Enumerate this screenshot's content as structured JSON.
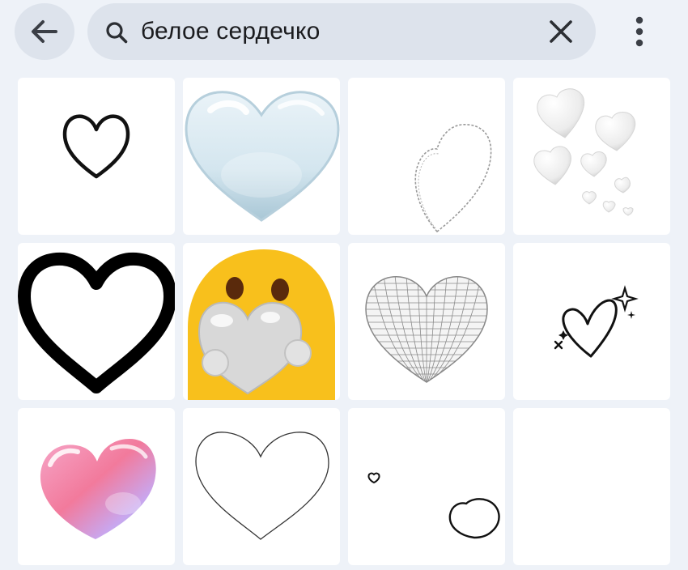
{
  "search": {
    "query": "белое сердечко"
  },
  "icons": {
    "back": "arrow-left-icon",
    "search": "search-icon",
    "clear": "close-icon",
    "more": "more-vertical-icon"
  },
  "colors": {
    "background": "#eef2f8",
    "search_bar": "#dde3ec",
    "tile": "#ffffff",
    "emoji_yellow": "#f8c01c"
  },
  "results": [
    {
      "name": "small-black-outline-heart"
    },
    {
      "name": "light-blue-glossy-heart"
    },
    {
      "name": "dotted-sketch-heart"
    },
    {
      "name": "white-puffy-hearts-cluster"
    },
    {
      "name": "thick-black-outline-heart"
    },
    {
      "name": "emoji-face-hugging-white-heart"
    },
    {
      "name": "wireframe-mesh-heart"
    },
    {
      "name": "doodle-heart-with-sparkles"
    },
    {
      "name": "pink-iridescent-glass-heart"
    },
    {
      "name": "thin-outline-heart"
    },
    {
      "name": "two-small-doodle-hearts"
    },
    {
      "name": "blank-white-result"
    }
  ]
}
